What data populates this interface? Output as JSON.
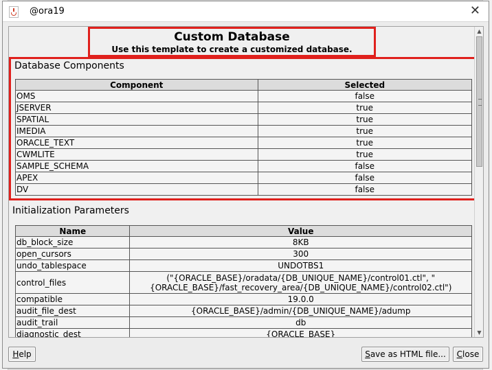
{
  "window": {
    "title": "@ora19",
    "close_glyph": "✕"
  },
  "header": {
    "title": "Custom Database",
    "subtitle": "Use this template to create a customized database."
  },
  "components": {
    "section_title": "Database Components",
    "columns": [
      "Component",
      "Selected"
    ],
    "rows": [
      [
        "OMS",
        "false"
      ],
      [
        "JSERVER",
        "true"
      ],
      [
        "SPATIAL",
        "true"
      ],
      [
        "IMEDIA",
        "true"
      ],
      [
        "ORACLE_TEXT",
        "true"
      ],
      [
        "CWMLITE",
        "true"
      ],
      [
        "SAMPLE_SCHEMA",
        "false"
      ],
      [
        "APEX",
        "false"
      ],
      [
        "DV",
        "false"
      ]
    ]
  },
  "init_params": {
    "section_title": "Initialization Parameters",
    "columns": [
      "Name",
      "Value"
    ],
    "rows": [
      [
        "db_block_size",
        "8KB"
      ],
      [
        "open_cursors",
        "300"
      ],
      [
        "undo_tablespace",
        "UNDOTBS1"
      ],
      [
        "control_files",
        "(\"{ORACLE_BASE}/oradata/{DB_UNIQUE_NAME}/control01.ctl\", \"{ORACLE_BASE}/fast_recovery_area/{DB_UNIQUE_NAME}/control02.ctl\")"
      ],
      [
        "compatible",
        "19.0.0"
      ],
      [
        "audit_file_dest",
        "{ORACLE_BASE}/admin/{DB_UNIQUE_NAME}/adump"
      ],
      [
        "audit_trail",
        "db"
      ],
      [
        "diagnostic_dest",
        "{ORACLE_BASE}"
      ]
    ]
  },
  "buttons": {
    "help": {
      "mnemonic": "H",
      "rest": "elp"
    },
    "save": {
      "mnemonic": "S",
      "rest": "ave as HTML file..."
    },
    "close": {
      "mnemonic": "C",
      "rest": "lose"
    }
  },
  "colors": {
    "highlight_border": "#e0201c",
    "link": "#1a3ea8"
  },
  "icons": {
    "window_icon": "java-icon",
    "close": "close-icon"
  }
}
